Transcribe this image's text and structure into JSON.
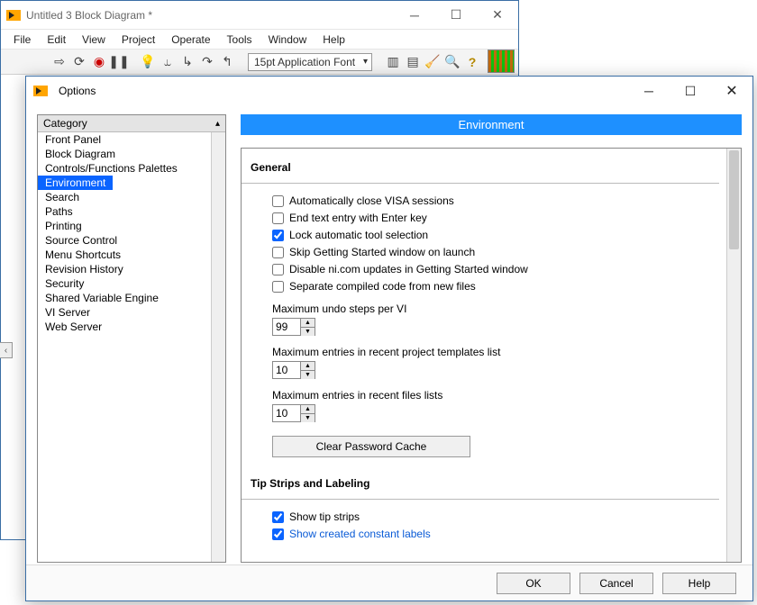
{
  "bd_window": {
    "title": "Untitled 3 Block Diagram *",
    "menu": [
      "File",
      "Edit",
      "View",
      "Project",
      "Operate",
      "Tools",
      "Window",
      "Help"
    ],
    "font_combo": "15pt Application Font"
  },
  "options": {
    "title": "Options",
    "category_header": "Category",
    "categories": [
      "Front Panel",
      "Block Diagram",
      "Controls/Functions Palettes",
      "Environment",
      "Search",
      "Paths",
      "Printing",
      "Source Control",
      "Menu Shortcuts",
      "Revision History",
      "Security",
      "Shared Variable Engine",
      "VI Server",
      "Web Server"
    ],
    "selected_index": 3,
    "banner": "Environment",
    "general": {
      "title": "General",
      "auto_close_visa": {
        "label": "Automatically close VISA sessions",
        "checked": false
      },
      "end_text_enter": {
        "label": "End text entry with Enter key",
        "checked": false
      },
      "lock_tool": {
        "label": "Lock automatic tool selection",
        "checked": true
      },
      "skip_getting_started": {
        "label": "Skip Getting Started window on launch",
        "checked": false
      },
      "disable_updates": {
        "label": "Disable ni.com updates in Getting Started window",
        "checked": false
      },
      "separate_compiled": {
        "label": "Separate compiled code from new files",
        "checked": false
      },
      "undo": {
        "label": "Maximum undo steps per VI",
        "value": "99"
      },
      "recent_templates": {
        "label": "Maximum entries in recent project templates list",
        "value": "10"
      },
      "recent_files": {
        "label": "Maximum entries in recent files lists",
        "value": "10"
      },
      "clear_password": "Clear Password Cache"
    },
    "tips": {
      "title": "Tip Strips and Labeling",
      "show_tip": {
        "label": "Show tip strips",
        "checked": true
      },
      "show_const": {
        "label": "Show created constant labels",
        "checked": true
      }
    },
    "buttons": {
      "ok": "OK",
      "cancel": "Cancel",
      "help": "Help"
    }
  }
}
